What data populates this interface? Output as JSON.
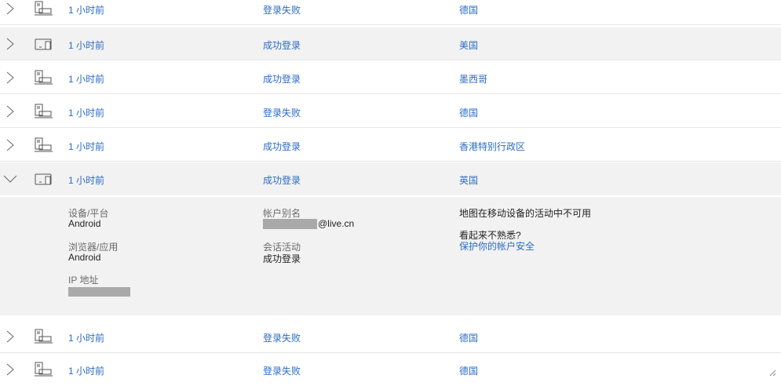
{
  "rows": [
    {
      "time": "1 小时前",
      "status": "登录失败",
      "location": "德国",
      "device": "desktop"
    },
    {
      "time": "1 小时前",
      "status": "成功登录",
      "location": "美国",
      "device": "tablet"
    },
    {
      "time": "1 小时前",
      "status": "成功登录",
      "location": "墨西哥",
      "device": "desktop"
    },
    {
      "time": "1 小时前",
      "status": "登录失败",
      "location": "德国",
      "device": "desktop"
    },
    {
      "time": "1 小时前",
      "status": "成功登录",
      "location": "香港特别行政区",
      "device": "desktop"
    },
    {
      "time": "1 小时前",
      "status": "成功登录",
      "location": "英国",
      "device": "tablet",
      "expanded": true
    },
    {
      "time": "1 小时前",
      "status": "登录失败",
      "location": "德国",
      "device": "desktop"
    },
    {
      "time": "1 小时前",
      "status": "登录失败",
      "location": "德国",
      "device": "desktop"
    }
  ],
  "detail": {
    "device_platform_label": "设备/平台",
    "device_platform_value": "Android",
    "browser_app_label": "浏览器/应用",
    "browser_app_value": "Android",
    "ip_label": "IP 地址",
    "account_alias_label": "帐户别名",
    "account_alias_suffix": "@live.cn",
    "session_activity_label": "会话活动",
    "session_activity_value": "成功登录",
    "map_unavailable": "地图在移动设备的活动中不可用",
    "unfamiliar_prompt": "看起来不熟悉?",
    "secure_account_link": "保护你的帐户安全"
  },
  "colors": {
    "link": "#2b6cc4",
    "row_shaded": "#f2f2f2",
    "icon": "#555555"
  }
}
